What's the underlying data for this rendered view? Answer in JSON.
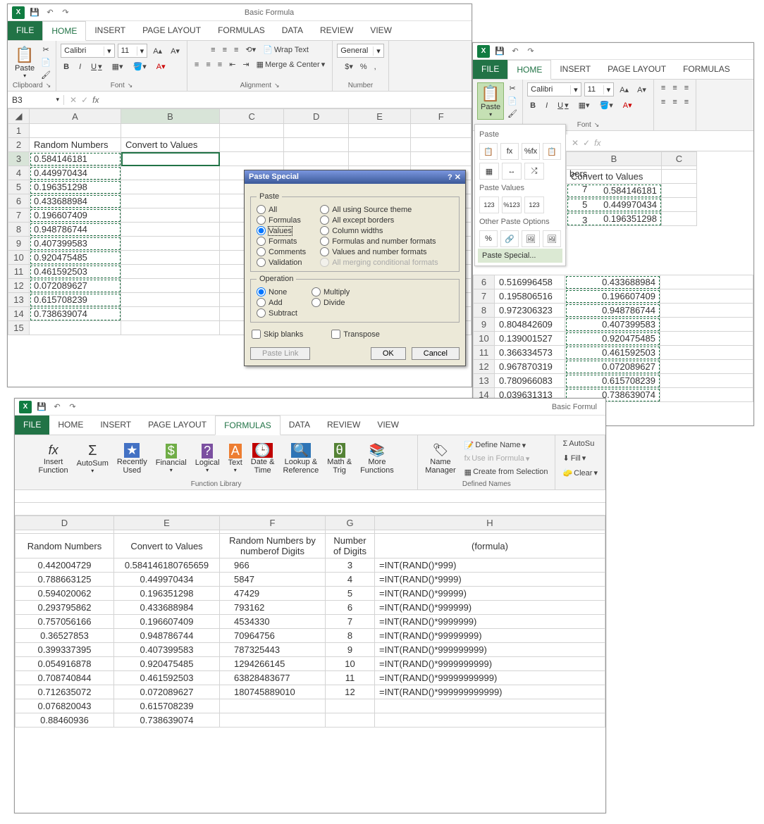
{
  "title": "Basic Formula",
  "title2": "Basic Formul",
  "namebox": "B3",
  "ribbon_tabs": {
    "file": "FILE",
    "home": "HOME",
    "insert": "INSERT",
    "page_layout": "PAGE LAYOUT",
    "formulas": "FORMULAS",
    "data": "DATA",
    "review": "REVIEW",
    "view": "VIEW"
  },
  "groups": {
    "clipboard": "Clipboard",
    "font": "Font",
    "alignment": "Alignment",
    "number": "Number",
    "function_library": "Function Library",
    "defined_names": "Defined Names"
  },
  "home": {
    "paste": "Paste",
    "font_name": "Calibri",
    "font_size": "11",
    "bold": "B",
    "italic": "I",
    "underline": "U",
    "wrap": "Wrap Text",
    "merge": "Merge & Center",
    "format": "General"
  },
  "formulas_ribbon": {
    "insert_fn": "Insert\nFunction",
    "autosum": "AutoSum",
    "recent": "Recently\nUsed",
    "financial": "Financial",
    "logical": "Logical",
    "text": "Text",
    "datetime": "Date &\nTime",
    "lookup": "Lookup &\nReference",
    "math": "Math &\nTrig",
    "more": "More\nFunctions",
    "name_mgr": "Name\nManager",
    "define": "Define Name",
    "usein": "Use in Formula",
    "create": "Create from Selection",
    "autosu": "AutoSu",
    "fill": "Fill",
    "clear": "Clear"
  },
  "paste_special": {
    "title": "Paste Special",
    "paste_legend": "Paste",
    "op_legend": "Operation",
    "all": "All",
    "formulas": "Formulas",
    "values": "Values",
    "formats": "Formats",
    "comments": "Comments",
    "validation": "Validation",
    "src_theme": "All using Source theme",
    "except_borders": "All except borders",
    "col_widths": "Column widths",
    "fmt_num": "Formulas and number formats",
    "val_num": "Values and number formats",
    "cond_fmt": "All merging conditional formats",
    "none": "None",
    "add": "Add",
    "subtract": "Subtract",
    "multiply": "Multiply",
    "divide": "Divide",
    "skip": "Skip blanks",
    "transpose": "Transpose",
    "paste_link": "Paste Link",
    "ok": "OK",
    "cancel": "Cancel"
  },
  "paste_menu": {
    "paste": "Paste",
    "paste_values": "Paste Values",
    "other": "Other Paste Options",
    "special": "Paste Special..."
  },
  "sheet1": {
    "headers": {
      "A": "Random Numbers",
      "B": "Convert to Values"
    },
    "rows": [
      {
        "r": 1,
        "A": "",
        "B": ""
      },
      {
        "r": 2,
        "A": "Random Numbers",
        "B": "Convert to Values"
      },
      {
        "r": 3,
        "A": "0.584146181",
        "B": ""
      },
      {
        "r": 4,
        "A": "0.449970434",
        "B": ""
      },
      {
        "r": 5,
        "A": "0.196351298",
        "B": ""
      },
      {
        "r": 6,
        "A": "0.433688984",
        "B": ""
      },
      {
        "r": 7,
        "A": "0.196607409",
        "B": ""
      },
      {
        "r": 8,
        "A": "0.948786744",
        "B": ""
      },
      {
        "r": 9,
        "A": "0.407399583",
        "B": ""
      },
      {
        "r": 10,
        "A": "0.920475485",
        "B": ""
      },
      {
        "r": 11,
        "A": "0.461592503",
        "B": ""
      },
      {
        "r": 12,
        "A": "0.072089627",
        "B": ""
      },
      {
        "r": 13,
        "A": "0.615708239",
        "B": ""
      },
      {
        "r": 14,
        "A": "0.738639074",
        "B": ""
      }
    ]
  },
  "sheet2": {
    "header_B": "Convert to Values",
    "partial_header": "bers",
    "rows": [
      {
        "r": 6,
        "A": "0.516996458",
        "B": "0.433688984",
        "Apart": "3"
      },
      {
        "r": 7,
        "A": "0.195806516",
        "B": "0.196607409",
        "Apart": "5"
      },
      {
        "r": 8,
        "A": "0.972306323",
        "B": "0.948786744",
        "Apart": "3"
      },
      {
        "r": 9,
        "A": "0.804842609",
        "B": "0.407399583"
      },
      {
        "r": 10,
        "A": "0.139001527",
        "B": "0.920475485"
      },
      {
        "r": 11,
        "A": "0.366334573",
        "B": "0.461592503"
      },
      {
        "r": 12,
        "A": "0.967870319",
        "B": "0.072089627"
      },
      {
        "r": 13,
        "A": "0.780966083",
        "B": "0.615708239"
      },
      {
        "r": 14,
        "A": "0.039631313",
        "B": "0.738639074"
      }
    ],
    "top_rows": [
      {
        "A": "7",
        "B": "0.584146181"
      },
      {
        "A": "5",
        "B": "0.449970434"
      },
      {
        "A": "3",
        "B": "0.196351298"
      }
    ]
  },
  "sheet3": {
    "headers": {
      "D": "Random Numbers",
      "E": "Convert to Values",
      "F": "Random Numbers by numberof Digits",
      "G": "Number of Digits",
      "H": "(formula)"
    },
    "rows": [
      {
        "D": "0.442004729",
        "E": "0.584146180765659",
        "F": "966",
        "G": "3",
        "H": "=INT(RAND()*999)"
      },
      {
        "D": "0.788663125",
        "E": "0.449970434",
        "F": "5847",
        "G": "4",
        "H": "=INT(RAND()*9999)"
      },
      {
        "D": "0.594020062",
        "E": "0.196351298",
        "F": "47429",
        "G": "5",
        "H": "=INT(RAND()*99999)"
      },
      {
        "D": "0.293795862",
        "E": "0.433688984",
        "F": "793162",
        "G": "6",
        "H": "=INT(RAND()*999999)"
      },
      {
        "D": "0.757056166",
        "E": "0.196607409",
        "F": "4534330",
        "G": "7",
        "H": "=INT(RAND()*9999999)"
      },
      {
        "D": "0.36527853",
        "E": "0.948786744",
        "F": "70964756",
        "G": "8",
        "H": "=INT(RAND()*99999999)"
      },
      {
        "D": "0.399337395",
        "E": "0.407399583",
        "F": "787325443",
        "G": "9",
        "H": "=INT(RAND()*999999999)"
      },
      {
        "D": "0.054916878",
        "E": "0.920475485",
        "F": "1294266145",
        "G": "10",
        "H": "=INT(RAND()*9999999999)"
      },
      {
        "D": "0.708740844",
        "E": "0.461592503",
        "F": "63828483677",
        "G": "11",
        "H": "=INT(RAND()*99999999999)"
      },
      {
        "D": "0.712635072",
        "E": "0.072089627",
        "F": "180745889010",
        "G": "12",
        "H": "=INT(RAND()*999999999999)"
      },
      {
        "D": "0.076820043",
        "E": "0.615708239",
        "F": "",
        "G": "",
        "H": ""
      },
      {
        "D": "0.88460936",
        "E": "0.738639074",
        "F": "",
        "G": "",
        "H": ""
      }
    ]
  }
}
